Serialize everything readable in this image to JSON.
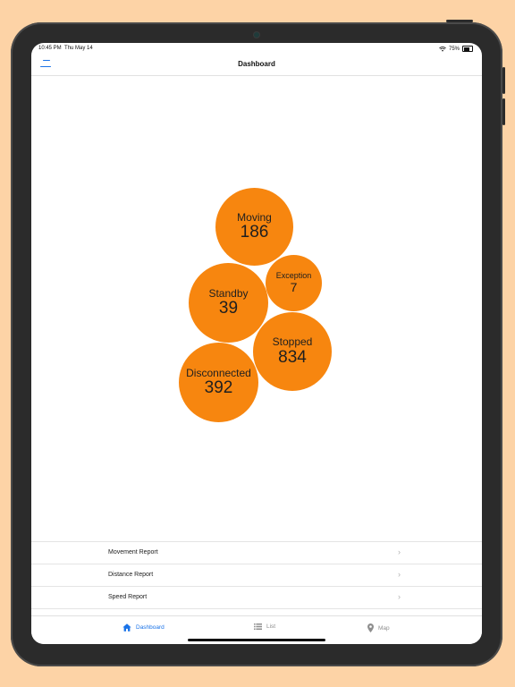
{
  "status": {
    "time": "10:45 PM",
    "date": "Thu May 14",
    "battery": "75%",
    "battery_level": 0.75
  },
  "header": {
    "title": "Dashboard"
  },
  "bubbles": [
    {
      "label": "Moving",
      "value": "186"
    },
    {
      "label": "Exception",
      "value": "7"
    },
    {
      "label": "Standby",
      "value": "39"
    },
    {
      "label": "Stopped",
      "value": "834"
    },
    {
      "label": "Disconnected",
      "value": "392"
    }
  ],
  "reports": [
    {
      "label": "Movement Report"
    },
    {
      "label": "Distance Report"
    },
    {
      "label": "Speed Report"
    }
  ],
  "tabs": [
    {
      "label": "Dashboard",
      "icon": "home-icon",
      "active": true
    },
    {
      "label": "List",
      "icon": "list-icon",
      "active": false
    },
    {
      "label": "Map",
      "icon": "map-pin-icon",
      "active": false
    }
  ],
  "colors": {
    "accent": "#1a73e8",
    "bubble": "#F7860F",
    "background": "#FDD3A6"
  }
}
